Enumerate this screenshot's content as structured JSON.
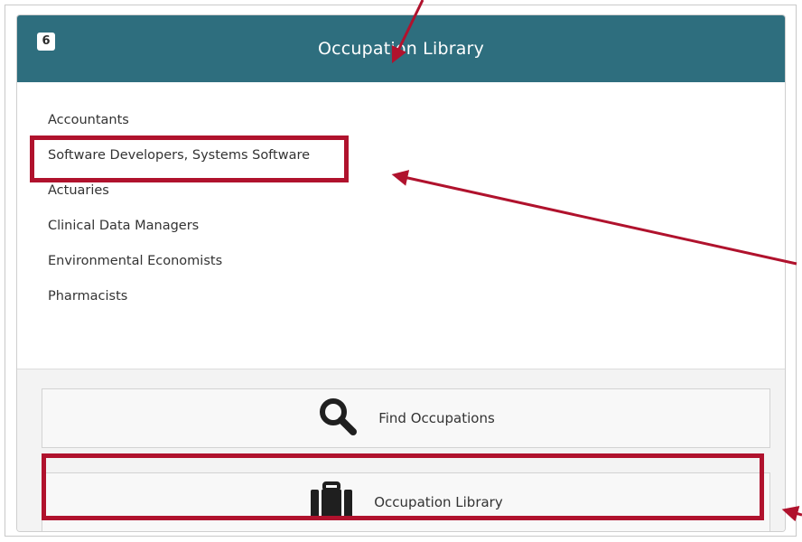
{
  "header": {
    "badge_count": "6",
    "title": "Occupation Library"
  },
  "occupations": [
    "Accountants",
    "Software Developers, Systems Software",
    "Actuaries",
    "Clinical Data Managers",
    "Environmental Economists",
    "Pharmacists"
  ],
  "actions": {
    "find_label": "Find Occupations",
    "library_label": "Occupation Library",
    "find_icon": "search-icon",
    "library_icon": "briefcase-icon"
  },
  "colors": {
    "header_bg": "#2e6e7e",
    "annotation": "#b0122d"
  }
}
